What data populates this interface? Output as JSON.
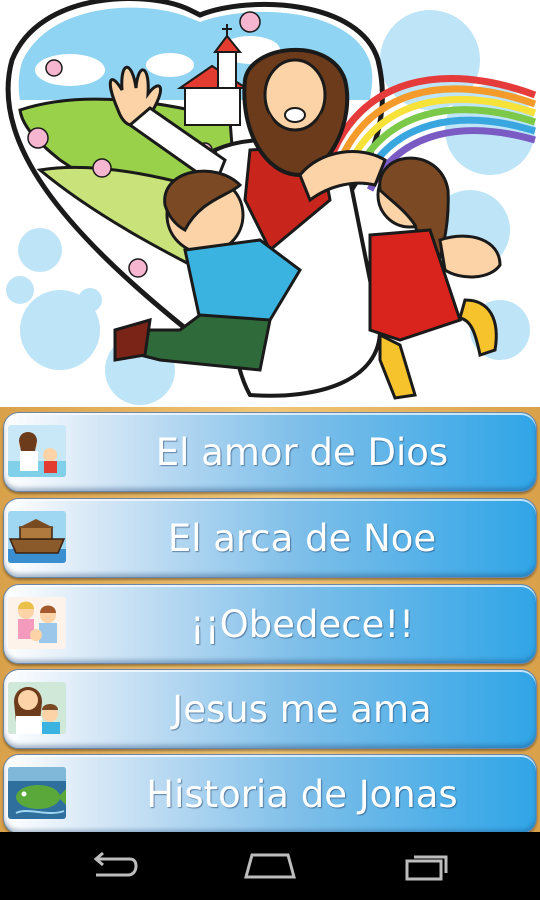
{
  "header": {
    "image": "jesus-with-children-illustration"
  },
  "stories": [
    {
      "label": "El amor de Dios",
      "thumb": "jesus-loves-thumbnail-icon"
    },
    {
      "label": "El arca de Noe",
      "thumb": "noah-ark-thumbnail-icon"
    },
    {
      "label": "¡¡Obedece!!",
      "thumb": "obey-family-thumbnail-icon"
    },
    {
      "label": "Jesus me ama",
      "thumb": "jesus-child-thumbnail-icon"
    },
    {
      "label": "Historia de Jonas",
      "thumb": "jonah-whale-thumbnail-icon"
    }
  ],
  "navbar": {
    "back": "back-icon",
    "home": "home-icon",
    "recents": "recent-apps-icon"
  },
  "colors": {
    "button_accent": "#30a5e7",
    "list_background": "#e3ad5c",
    "nav_background": "#000000"
  }
}
